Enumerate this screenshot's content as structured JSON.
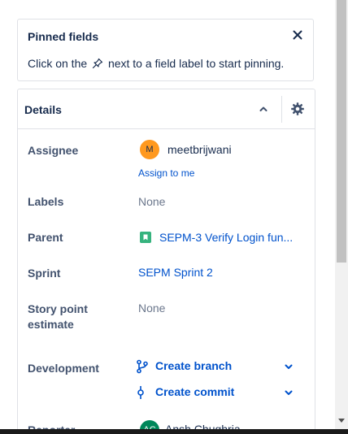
{
  "pinned": {
    "title": "Pinned fields",
    "desc_before": "Click on the",
    "desc_after": "next to a field label to start pinning."
  },
  "details": {
    "title": "Details",
    "fields": {
      "assignee_label": "Assignee",
      "assignee_initial": "M",
      "assignee_name": "meetbrijwani",
      "assign_to_me": "Assign to me",
      "labels_label": "Labels",
      "labels_value": "None",
      "parent_label": "Parent",
      "parent_value": "SEPM-3 Verify Login fun...",
      "sprint_label": "Sprint",
      "sprint_value": "SEPM Sprint 2",
      "story_point_label_1": "Story point",
      "story_point_label_2": "estimate",
      "story_point_value": "None",
      "development_label": "Development",
      "create_branch": "Create branch",
      "create_commit": "Create commit",
      "reporter_label": "Reporter",
      "reporter_initials": "AC",
      "reporter_name": "Ansh Chughria"
    }
  },
  "colors": {
    "link": "#0052cc",
    "assignee_avatar": "#ff991f",
    "reporter_avatar": "#00875a",
    "story_icon": "#36b37e"
  }
}
